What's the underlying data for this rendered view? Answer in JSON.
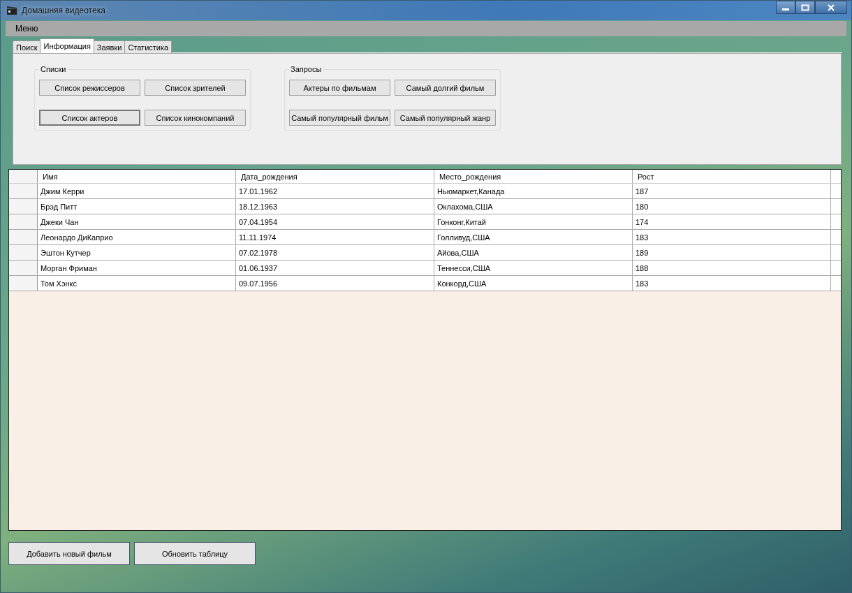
{
  "window": {
    "title": "Домашняя видеотека"
  },
  "menu": [
    {
      "label": "Меню"
    }
  ],
  "tabs": [
    {
      "label": "Поиск",
      "selected": false
    },
    {
      "label": "Информация",
      "selected": true
    },
    {
      "label": "Заявки",
      "selected": false
    },
    {
      "label": "Статистика",
      "selected": false
    }
  ],
  "groups": [
    {
      "title": "Списки",
      "buttons": [
        {
          "label": "Список режиссеров",
          "focused": false
        },
        {
          "label": "Список зрителей",
          "focused": false
        },
        {
          "label": "Список актеров",
          "focused": true
        },
        {
          "label": "Список кинокомпаний",
          "focused": false
        }
      ]
    },
    {
      "title": "Запросы",
      "buttons": [
        {
          "label": "Актеры по фильмам",
          "focused": false
        },
        {
          "label": "Самый долгий фильм",
          "focused": false
        },
        {
          "label": "Самый популярный фильм",
          "focused": false
        },
        {
          "label": "Самый популярный жанр",
          "focused": false
        }
      ]
    }
  ],
  "table": {
    "columns": [
      "Имя",
      "Дата_рождения",
      "Место_рождения",
      "Рост"
    ],
    "rows": [
      [
        "Джим Керри",
        "17.01.1962",
        "Ньюмаркет,Канада",
        "187"
      ],
      [
        "Брэд Питт",
        "18.12.1963",
        "Оклахома,США",
        "180"
      ],
      [
        "Джеки Чан",
        "07.04.1954",
        "Гонконг,Китай",
        "174"
      ],
      [
        "Леонардо ДиКаприо",
        "11.11.1974",
        "Голливуд,США",
        "183"
      ],
      [
        "Эштон Кутчер",
        "07.02.1978",
        "Айова,США",
        "189"
      ],
      [
        "Морган Фриман",
        "01.06.1937",
        "Теннесси,США",
        "188"
      ],
      [
        "Том Хэнкс",
        "09.07.1956",
        "Конкорд,США",
        "183"
      ]
    ]
  },
  "buttons": [
    "Добавить новый фильм",
    "Обновить таблицу"
  ]
}
